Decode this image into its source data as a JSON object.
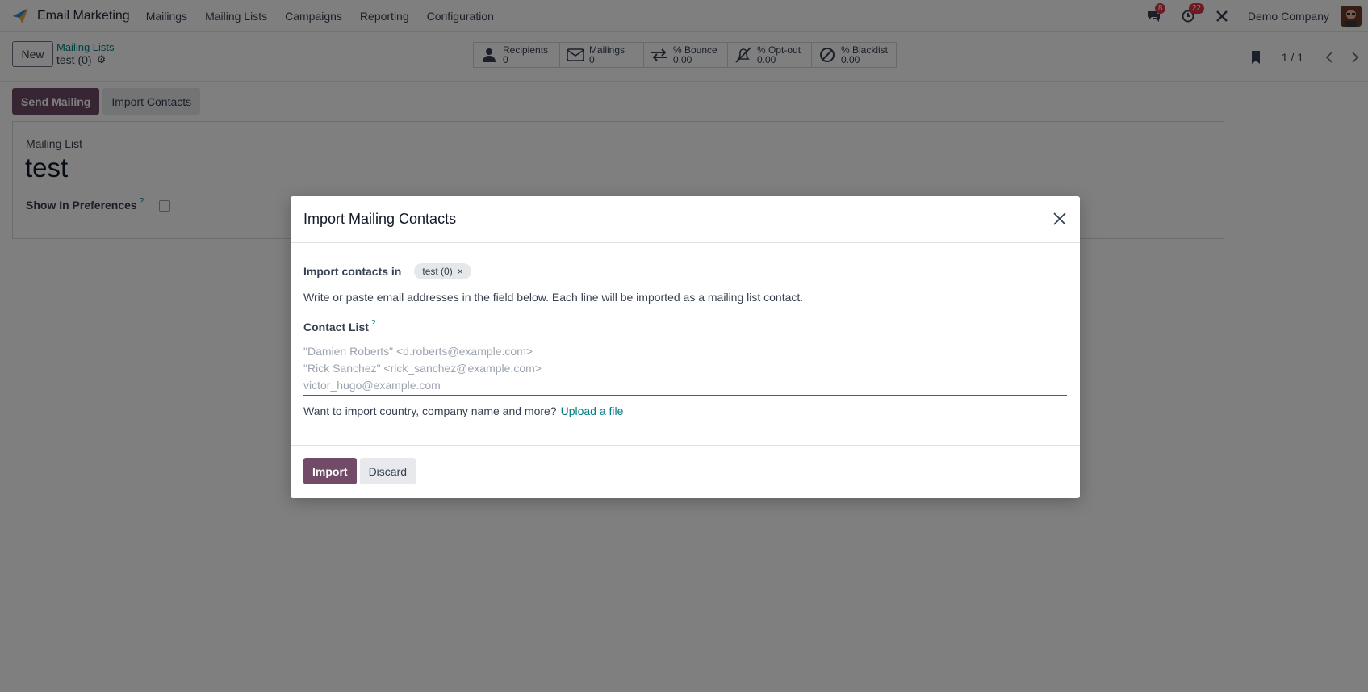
{
  "navbar": {
    "app_name": "Email Marketing",
    "menu": [
      "Mailings",
      "Mailing Lists",
      "Campaigns",
      "Reporting",
      "Configuration"
    ],
    "messages_count": "8",
    "activities_count": "22",
    "company": "Demo Company"
  },
  "control_panel": {
    "new_label": "New",
    "breadcrumb_parent": "Mailing Lists",
    "breadcrumb_current": "test (0)",
    "stats": [
      {
        "label": "Recipients",
        "value": "0",
        "icon": "user-icon"
      },
      {
        "label": "Mailings",
        "value": "0",
        "icon": "envelope-icon"
      },
      {
        "label": "% Bounce",
        "value": "0.00",
        "icon": "exchange-icon"
      },
      {
        "label": "% Opt-out",
        "value": "0.00",
        "icon": "bell-slash-icon"
      },
      {
        "label": "% Blacklist",
        "value": "0.00",
        "icon": "ban-icon"
      }
    ],
    "pager": "1 / 1"
  },
  "form": {
    "send_mailing_label": "Send Mailing",
    "import_contacts_label": "Import Contacts",
    "mailing_list_label": "Mailing List",
    "mailing_list_name": "test",
    "show_in_preferences_label": "Show In Preferences",
    "help_mark": "?"
  },
  "modal": {
    "title": "Import Mailing Contacts",
    "import_in_label": "Import contacts in",
    "tag_label": "test (0)",
    "tag_remove": "×",
    "instructions": "Write or paste email addresses in the field below. Each line will be imported as a mailing list contact.",
    "contact_list_label": "Contact List",
    "help_mark": "?",
    "placeholder": "\"Damien Roberts\" <d.roberts@example.com>\n\"Rick Sanchez\" <rick_sanchez@example.com>\nvictor_hugo@example.com",
    "upload_prompt": "Want to import country, company name and more?",
    "upload_link": "Upload a file",
    "import_label": "Import",
    "discard_label": "Discard"
  },
  "colors": {
    "primary": "#714b67",
    "link": "#017e84",
    "badge": "#dc3545"
  }
}
